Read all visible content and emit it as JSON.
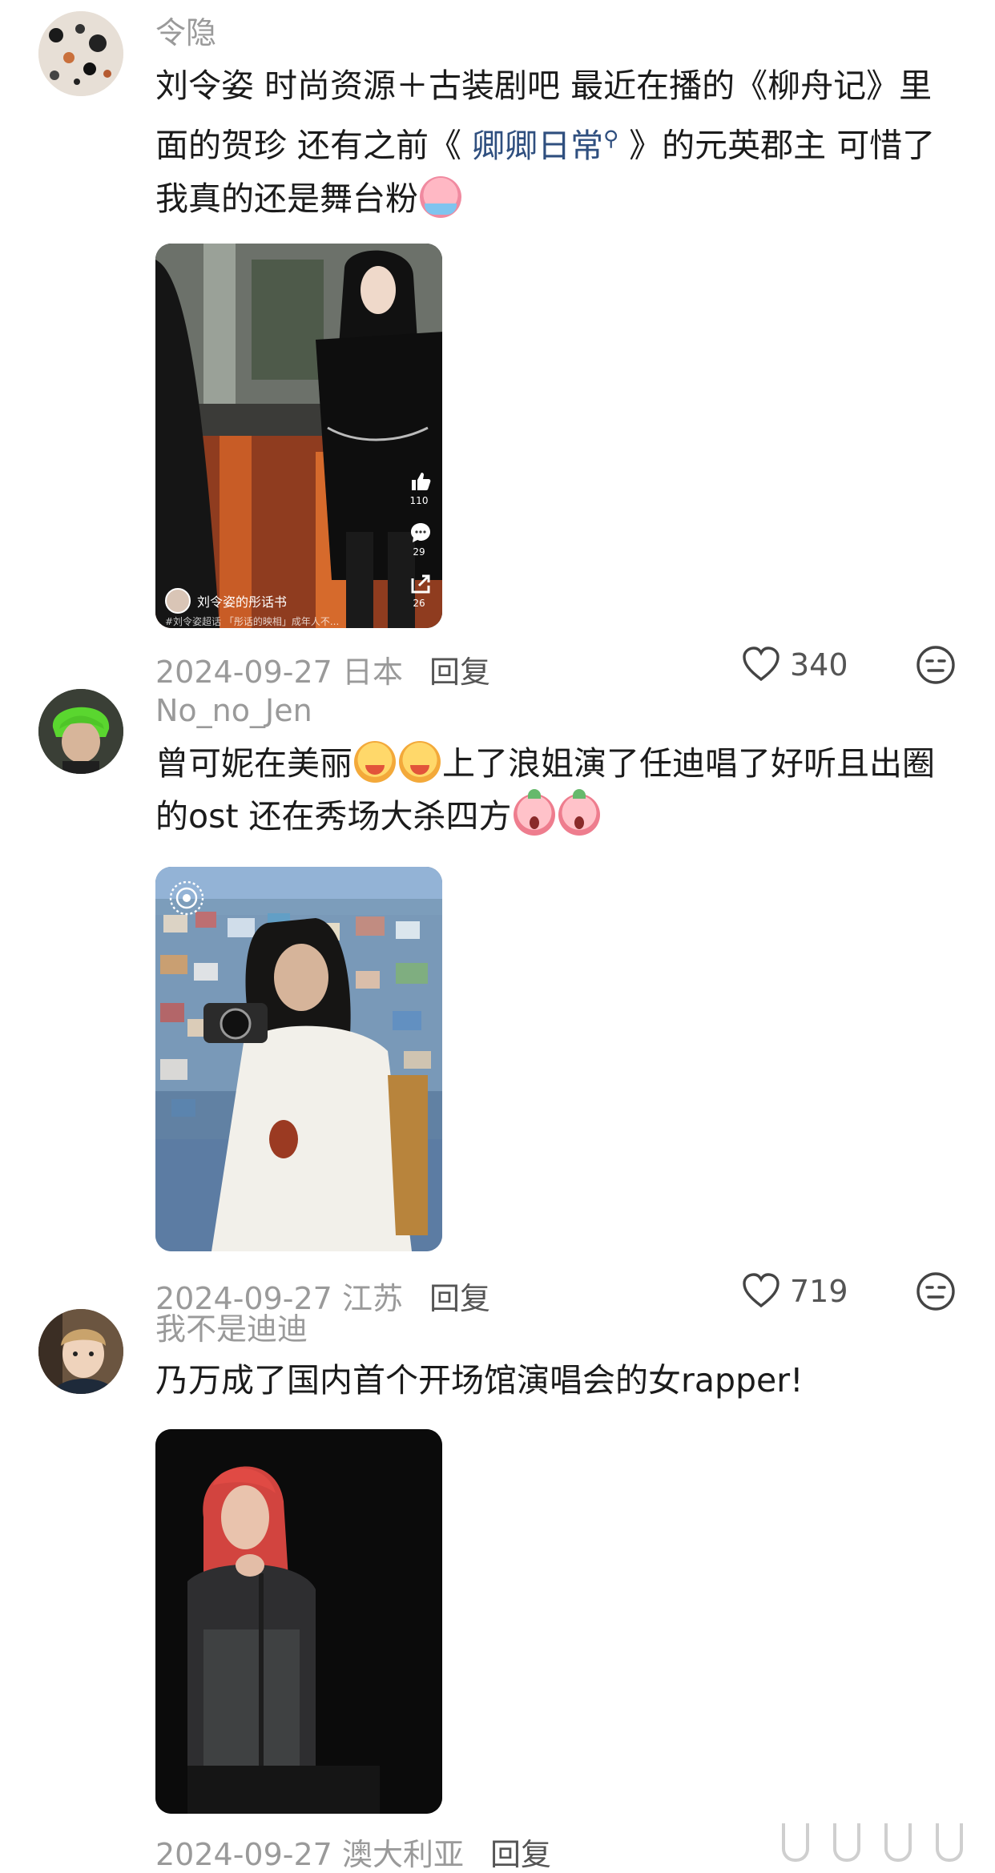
{
  "comments": [
    {
      "username": "令隐",
      "text_parts": {
        "part1": "刘令姿  时尚资源＋古装剧吧  最近在播的《柳舟记》里面的贺珍  还有之前《 ",
        "link": "卿卿日常",
        "part2": " 》的元英郡主  可惜了我真的还是舞台粉"
      },
      "emoji": "crying-emoji",
      "photo": {
        "author": "刘令姿的彤话书",
        "sub_caption": "#刘令姿超话  「彤话的映相」成年人不...",
        "like_count": "110",
        "comment_count": "29",
        "share_count": "26"
      },
      "date": "2024-09-27",
      "location": "日本",
      "reply_label": "回复",
      "likes": "340"
    },
    {
      "username": "No_no_Jen",
      "text_parts": {
        "part1": "曾可妮在美丽",
        "part2": "上了浪姐演了任迪唱了好听且出圈的ost 还在秀场大杀四方"
      },
      "emoji": "drooling-emoji",
      "emoji_end": "shocked-emoji",
      "date": "2024-09-27",
      "location": "江苏",
      "reply_label": "回复",
      "likes": "719"
    },
    {
      "username": "我不是迪迪",
      "text": "乃万成了国内首个开场馆演唱会的女rapper!",
      "date": "2024-09-27",
      "location": "澳大利亚",
      "reply_label": "回复"
    }
  ],
  "icons": {
    "like": "heart-outline-icon",
    "reaction": "neutral-face-icon"
  },
  "colors": {
    "meta_gray": "#9a9a9a",
    "link_blue": "#2f4f7f"
  }
}
